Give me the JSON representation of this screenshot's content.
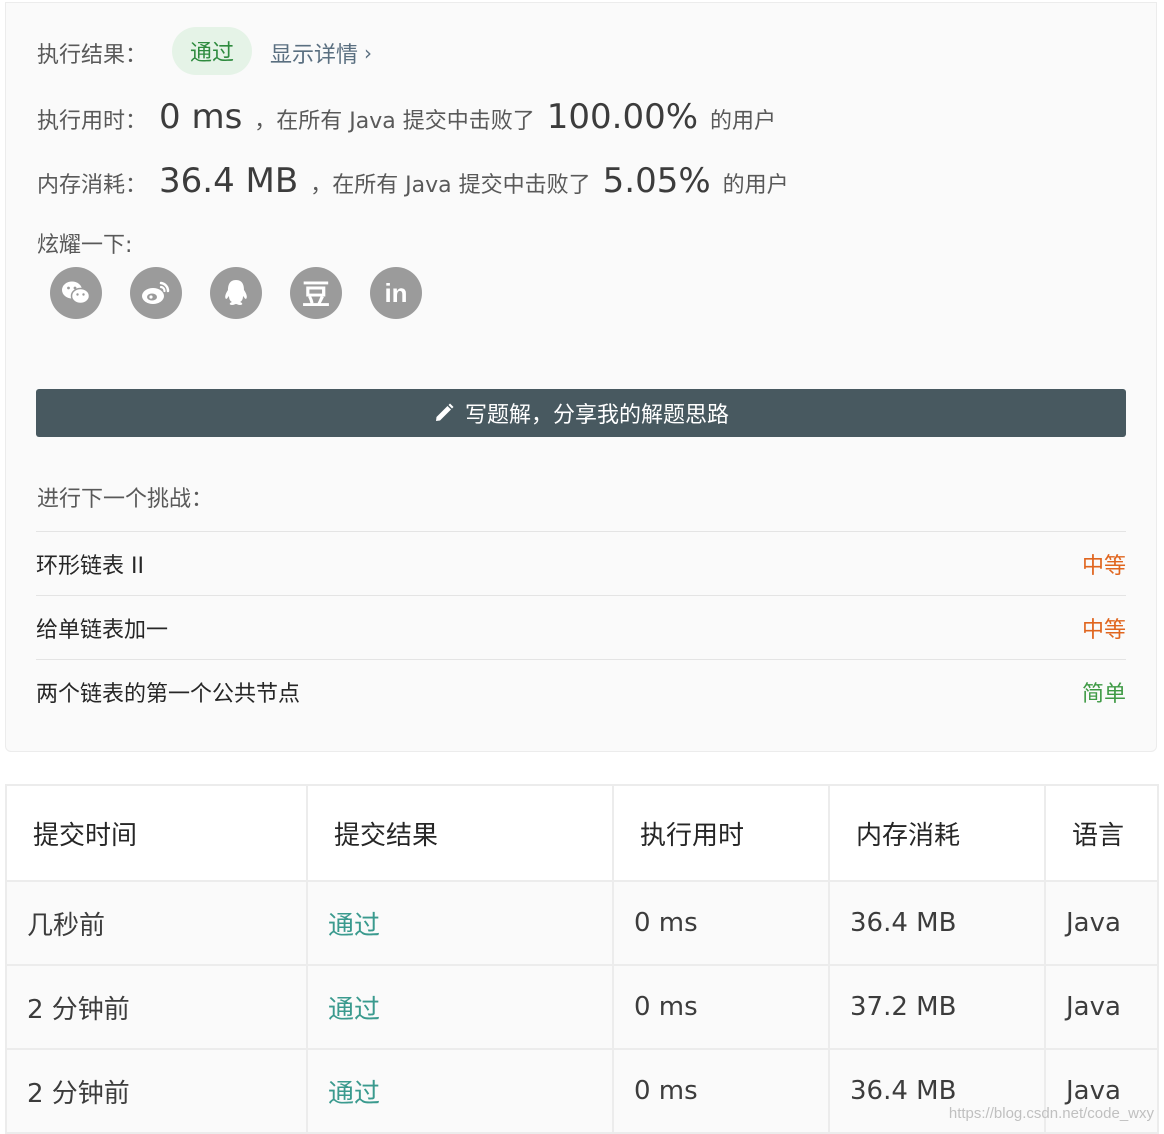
{
  "result": {
    "label": "执行结果：",
    "status": "通过",
    "detail_link": "显示详情",
    "chevron": "›"
  },
  "runtime": {
    "label": "执行用时：",
    "value": "0 ms",
    "middle": "，在所有 Java 提交中击败了",
    "percent": "100.00%",
    "suffix": "的用户"
  },
  "memory": {
    "label": "内存消耗：",
    "value": "36.4 MB",
    "middle": "，在所有 Java 提交中击败了",
    "percent": "5.05%",
    "suffix": "的用户"
  },
  "share": {
    "label": "炫耀一下:",
    "items": [
      {
        "icon": "wechat-icon"
      },
      {
        "icon": "weibo-icon"
      },
      {
        "icon": "qq-icon"
      },
      {
        "icon": "douban-icon",
        "glyph": "豆"
      },
      {
        "icon": "linkedin-icon",
        "glyph": "in"
      }
    ]
  },
  "write_solution": {
    "label": "写题解，分享我的解题思路",
    "icon": "pencil-icon"
  },
  "next_challenge": {
    "title": "进行下一个挑战：",
    "items": [
      {
        "name": "环形链表 II",
        "difficulty": "中等",
        "color": "#e0651e"
      },
      {
        "name": "给单链表加一",
        "difficulty": "中等",
        "color": "#e0651e"
      },
      {
        "name": "两个链表的第一个公共节点",
        "difficulty": "简单",
        "color": "#3f9a45"
      }
    ]
  },
  "submissions": {
    "columns": [
      "提交时间",
      "提交结果",
      "执行用时",
      "内存消耗",
      "语言"
    ],
    "rows": [
      [
        "几秒前",
        "通过",
        "0 ms",
        "36.4 MB",
        "Java"
      ],
      [
        "2 分钟前",
        "通过",
        "0 ms",
        "37.2 MB",
        "Java"
      ],
      [
        "2 分钟前",
        "通过",
        "0 ms",
        "36.4 MB",
        "Java"
      ]
    ]
  },
  "watermark": "https://blog.csdn.net/code_wxy",
  "colors": {
    "pass_green": "#2e8b3e",
    "pass_teal": "#3a9a8e",
    "medium_orange": "#e0651e",
    "easy_green": "#3f9a45",
    "button_bg": "#485960"
  }
}
